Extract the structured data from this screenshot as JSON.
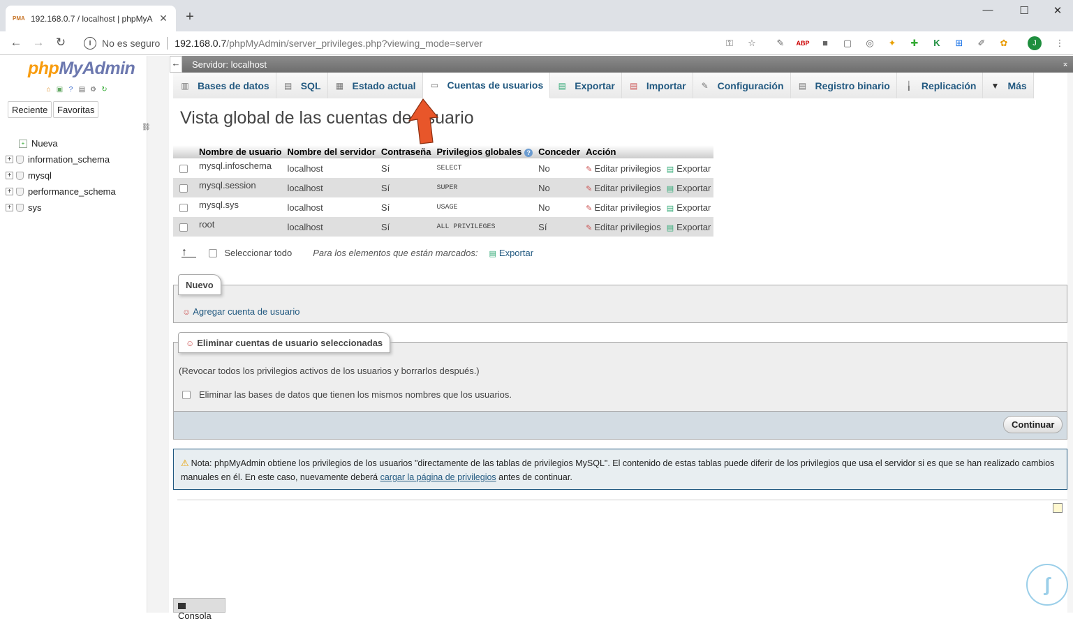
{
  "browser": {
    "tab_title": "192.168.0.7 / localhost | phpMyA",
    "favicon_text": "PMA",
    "security_label": "No es seguro",
    "url_host": "192.168.0.7",
    "url_path": "/phpMyAdmin/server_privileges.php?viewing_mode=server",
    "avatar_letter": "J"
  },
  "sidebar": {
    "logo_php": "php",
    "logo_my": "MyAdmin",
    "recent_label": "Reciente",
    "favorites_label": "Favoritas",
    "tree": [
      {
        "label": "Nueva"
      },
      {
        "label": "information_schema"
      },
      {
        "label": "mysql"
      },
      {
        "label": "performance_schema"
      },
      {
        "label": "sys"
      }
    ]
  },
  "server_bar": {
    "label": "Servidor: localhost"
  },
  "tabs": [
    {
      "label": "Bases de datos"
    },
    {
      "label": "SQL"
    },
    {
      "label": "Estado actual"
    },
    {
      "label": "Cuentas de usuarios",
      "active": true
    },
    {
      "label": "Exportar"
    },
    {
      "label": "Importar"
    },
    {
      "label": "Configuración"
    },
    {
      "label": "Registro binario"
    },
    {
      "label": "Replicación"
    },
    {
      "label": "Más"
    }
  ],
  "page_title": "Vista global de las cuentas de usuario",
  "table": {
    "headers": [
      "Nombre de usuario",
      "Nombre del servidor",
      "Contraseña",
      "Privilegios globales",
      "Conceder",
      "Acción"
    ],
    "rows": [
      {
        "user": "mysql.infoschema",
        "host": "localhost",
        "password": "Sí",
        "privileges": "SELECT",
        "grant": "No"
      },
      {
        "user": "mysql.session",
        "host": "localhost",
        "password": "Sí",
        "privileges": "SUPER",
        "grant": "No"
      },
      {
        "user": "mysql.sys",
        "host": "localhost",
        "password": "Sí",
        "privileges": "USAGE",
        "grant": "No"
      },
      {
        "user": "root",
        "host": "localhost",
        "password": "Sí",
        "privileges": "ALL PRIVILEGES",
        "grant": "Sí"
      }
    ],
    "edit_label": "Editar privilegios",
    "export_label": "Exportar"
  },
  "bulk": {
    "select_all": "Seleccionar todo",
    "with_selected": "Para los elementos que están marcados:",
    "export_label": "Exportar"
  },
  "new_section": {
    "legend": "Nuevo",
    "add_user": "Agregar cuenta de usuario"
  },
  "delete_section": {
    "legend": "Eliminar cuentas de usuario seleccionadas",
    "description": "(Revocar todos los privilegios activos de los usuarios y borrarlos después.)",
    "drop_db_label": "Eliminar las bases de datos que tienen los mismos nombres que los usuarios.",
    "continue_label": "Continuar"
  },
  "note": {
    "text_before": "Nota: phpMyAdmin obtiene los privilegios de los usuarios \"directamente de las tablas de privilegios MySQL\". El contenido de estas tablas puede diferir de los privilegios que usa el servidor si es que se han realizado cambios manuales en él. En este caso, nuevamente deberá ",
    "link": "cargar la página de privilegios",
    "text_after": " antes de continuar."
  },
  "console_label": "Consola",
  "colors": {
    "link": "#235a81",
    "accent": "#f89c0e",
    "arrow": "#e8562a"
  }
}
